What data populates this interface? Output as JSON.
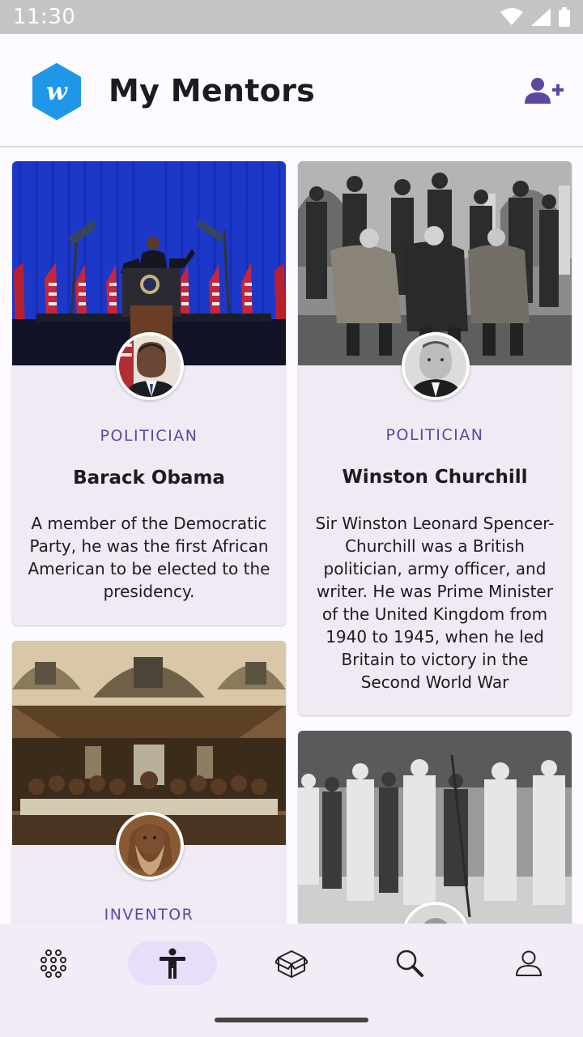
{
  "status_bar": {
    "time": "11:30"
  },
  "app_bar": {
    "title": "My Mentors",
    "logo_letter": "w"
  },
  "colors": {
    "accent": "#5b48a2",
    "logo": "#1e98e6",
    "card_bg": "#efeaf4"
  },
  "cards": [
    {
      "category": "POLITICIAN",
      "name": "Barack Obama",
      "description": "A member of the Democratic Party, he was the first African American to be elected to the presidency."
    },
    {
      "category": "POLITICIAN",
      "name": "Winston Churchill",
      "description": "Sir Winston Leonard Spencer-Churchill was a British politician, army officer, and writer. He was Prime Minister of the United Kingdom from 1940 to 1945, when he led Britain to victory in the Second World War"
    },
    {
      "category": "INVENTOR",
      "name": "",
      "description": ""
    },
    {
      "category": "",
      "name": "",
      "description": ""
    }
  ],
  "bottom_nav": [
    {
      "icon": "grid-dots-icon",
      "active": false
    },
    {
      "icon": "person-accessibility-icon",
      "active": true
    },
    {
      "icon": "box-icon",
      "active": false
    },
    {
      "icon": "search-icon",
      "active": false
    },
    {
      "icon": "profile-icon",
      "active": false
    }
  ]
}
